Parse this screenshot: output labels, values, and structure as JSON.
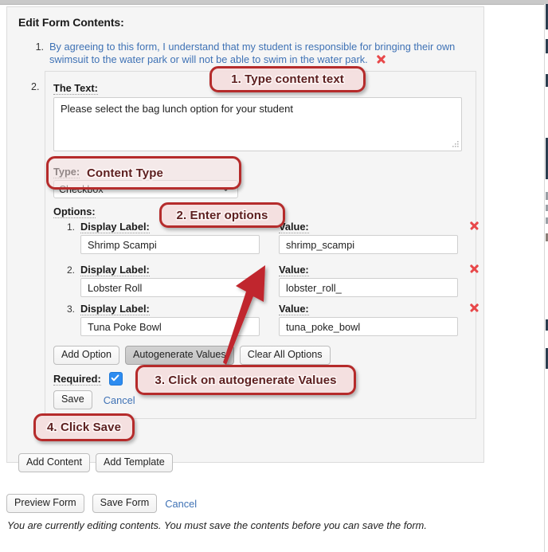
{
  "page_title": "Edit Form Contents:",
  "contents": [
    {
      "number": "1.",
      "text": "By agreeing to this form, I understand that my student is responsible for bringing their own swimsuit to the water park or will not be able to swim in the water park.",
      "delete_icon": "red-x-icon"
    },
    {
      "number": "2."
    }
  ],
  "edit_box": {
    "the_text_label": "The Text:",
    "the_text_value": "Please select the bag lunch option for your student",
    "the_text_placeholder": "",
    "resize_grip_icon": "resize-grip-icon",
    "type_label": "Type:",
    "type_value": "Checkbox",
    "type_options": [
      "Checkbox"
    ],
    "type_caret_icon": "chevron-down-icon",
    "options_label": "Options:",
    "option_column_headers": {
      "display_label": "Display Label:",
      "value": "Value:"
    },
    "options": [
      {
        "number": "1.",
        "display_label_header": "Display Label:",
        "value_header": "Value:",
        "display_label": "Shrimp Scampi",
        "value": "shrimp_scampi",
        "delete_icon": "red-x-icon"
      },
      {
        "number": "2.",
        "display_label_header": "Display Label:",
        "value_header": "Value:",
        "display_label": "Lobster Roll",
        "value": "lobster_roll_",
        "delete_icon": "red-x-icon"
      },
      {
        "number": "3.",
        "display_label_header": "Display Label:",
        "value_header": "Value:",
        "display_label": "Tuna Poke Bowl",
        "value": "tuna_poke_bowl",
        "delete_icon": "red-x-icon"
      }
    ],
    "option_buttons": [
      {
        "label": "Add Option",
        "state": "normal"
      },
      {
        "label": "Autogenerate Values",
        "state": "pressed"
      },
      {
        "label": "Clear All Options",
        "state": "normal"
      }
    ],
    "required_label": "Required:",
    "required_checked": true,
    "required_check_icon": "checkmark-icon",
    "save_label": "Save",
    "cancel_label": "Cancel"
  },
  "outer_buttons": [
    {
      "label": "Add Content"
    },
    {
      "label": "Add Template"
    }
  ],
  "footer": {
    "buttons": [
      {
        "label": "Preview Form"
      },
      {
        "label": "Save Form"
      }
    ],
    "cancel_label": "Cancel",
    "note": "You are currently editing contents. You must save the contents before you can save the form."
  },
  "annotations": {
    "arrow_icon": "red-arrow-icon",
    "callouts": [
      {
        "id": "callout-1",
        "text": "1. Type content text"
      },
      {
        "id": "callout-2",
        "text": "Content Type"
      },
      {
        "id": "callout-3",
        "text": "2. Enter options"
      },
      {
        "id": "callout-4",
        "text": "3. Click on autogenerate Values"
      },
      {
        "id": "callout-5",
        "text": "4. Click Save"
      }
    ]
  },
  "colors": {
    "callout_border": "#b52b2b",
    "callout_fill": "#f3dede",
    "callout_text": "#5c1f1f",
    "link": "#3f72b5",
    "delete_x": "#e8484a",
    "checkbox": "#2d8cf0",
    "arrow": "#c0272d"
  }
}
